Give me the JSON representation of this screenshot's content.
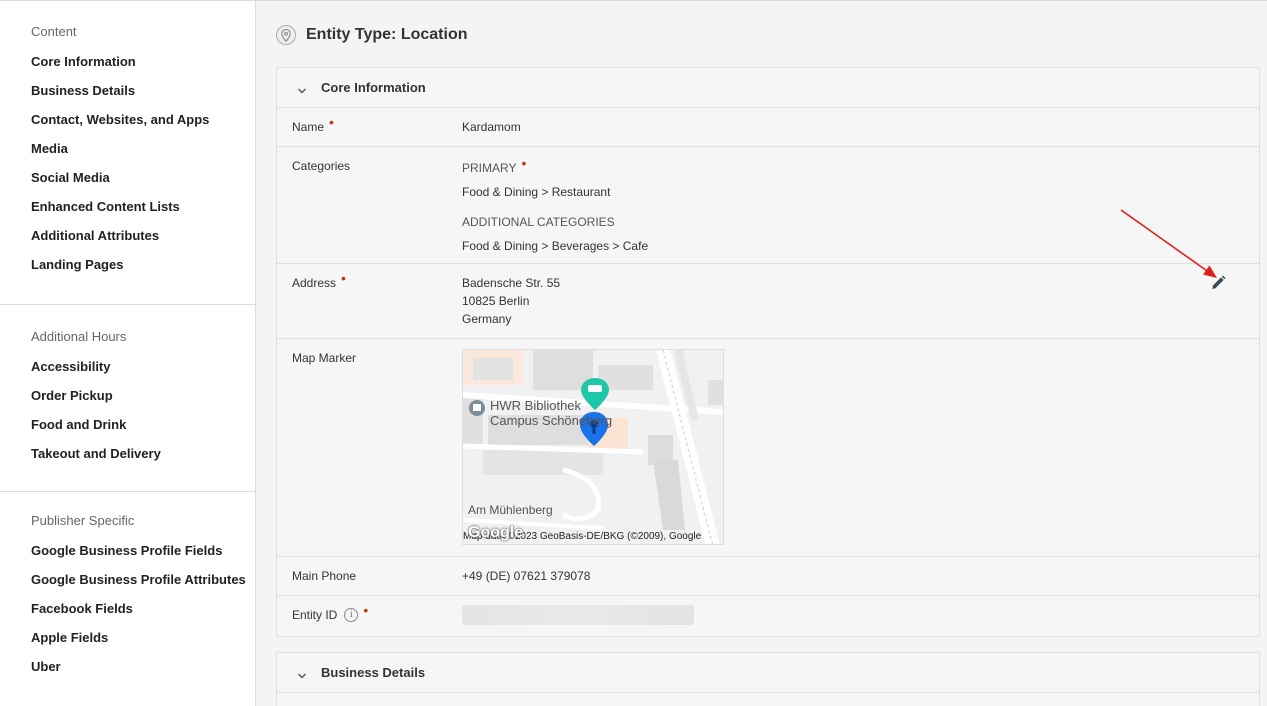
{
  "sidebar": {
    "sections": [
      {
        "heading": "Content",
        "items": [
          "Core Information",
          "Business Details",
          "Contact, Websites, and Apps",
          "Media",
          "Social Media",
          "Enhanced Content Lists",
          "Additional Attributes",
          "Landing Pages"
        ]
      },
      {
        "heading": "Additional Hours",
        "items": [
          "Accessibility",
          "Order Pickup",
          "Food and Drink",
          "Takeout and Delivery"
        ]
      },
      {
        "heading": "Publisher Specific",
        "items": [
          "Google Business Profile Fields",
          "Google Business Profile Attributes",
          "Facebook Fields",
          "Apple Fields",
          "Uber"
        ]
      }
    ]
  },
  "page": {
    "title": "Entity Type: Location",
    "icon": "location-pin-icon"
  },
  "core_panel": {
    "title": "Core Information",
    "fields": {
      "name": {
        "label": "Name",
        "value": "Kardamom"
      },
      "categories": {
        "label": "Categories",
        "primary_label": "PRIMARY",
        "primary_value": "Food & Dining > Restaurant",
        "additional_label": "ADDITIONAL CATEGORIES",
        "additional_value": "Food & Dining > Beverages > Cafe"
      },
      "address": {
        "label": "Address",
        "lines": [
          "Badensche Str. 55",
          "10825 Berlin",
          "Germany"
        ],
        "edit_icon": "pencil-icon"
      },
      "map_marker": {
        "label": "Map Marker",
        "map": {
          "place_label_1": "HWR Bibliothek",
          "place_label_2": "Campus Schöneberg",
          "street_label": "Am Mühlenberg",
          "logo": "Google",
          "copyright": "Map data ©2023 GeoBasis-DE/BKG (©2009), Google"
        }
      },
      "main_phone": {
        "label": "Main Phone",
        "value": "+49 (DE) 07621 379078"
      },
      "entity_id": {
        "label": "Entity ID",
        "value_hidden": true
      }
    }
  },
  "biz_panel": {
    "title": "Business Details"
  },
  "colors": {
    "required_dot": "#c8370b",
    "annotation_arrow": "#e02020",
    "marker_blue": "#1a73e8",
    "marker_teal": "#1fc7a8"
  }
}
